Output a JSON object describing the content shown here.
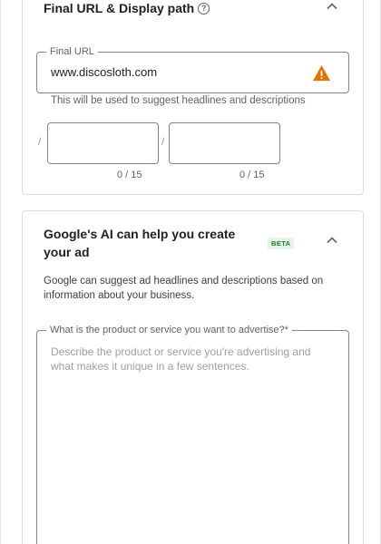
{
  "url_section": {
    "title": "Final URL & Display path",
    "help_glyph": "?",
    "final_url": {
      "label": "Final URL",
      "value": "www.discosloth.com",
      "warning_color": "#e37400"
    },
    "hint": "This will be used to suggest headlines and descriptions",
    "path_separator": "/",
    "path1": {
      "counter": "0 / 15"
    },
    "path2": {
      "counter": "0 / 15"
    }
  },
  "ai_section": {
    "title": "Google's AI can help you create your ad",
    "badge": "BETA",
    "description": "Google can suggest ad headlines and descriptions based on information about your business.",
    "product_field": {
      "label": "What is the product or service you want to advertise?*",
      "placeholder": "Describe the product or service you're advertising and what makes it unique in a few sentences."
    }
  }
}
